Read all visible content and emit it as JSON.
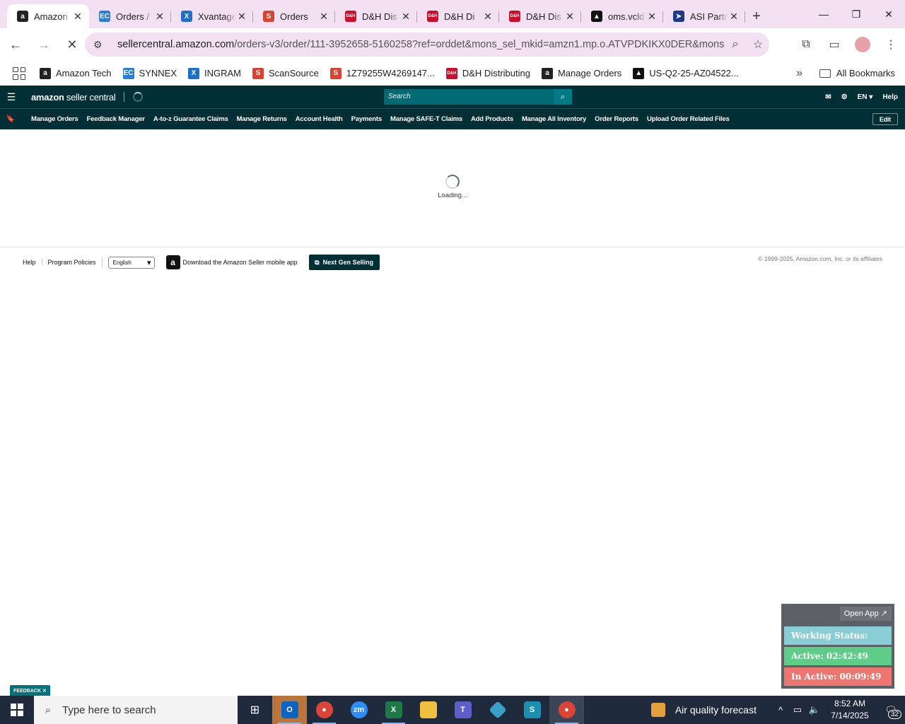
{
  "browser": {
    "tabs": [
      {
        "title": "Amazon",
        "favicon": "amazon-icon",
        "color": "#222222",
        "glyph": "a",
        "active": true
      },
      {
        "title": "Orders /",
        "favicon": "ec-icon",
        "color": "#2a7fd4",
        "glyph": "EC",
        "active": false
      },
      {
        "title": "Xvantage",
        "favicon": "xvantage-icon",
        "color": "#1e6fc9",
        "glyph": "X",
        "active": false
      },
      {
        "title": "Orders",
        "favicon": "scansource-icon",
        "color": "#d9432f",
        "glyph": "S",
        "active": false
      },
      {
        "title": "D&H Dis",
        "favicon": "dh-icon",
        "color": "#c8102e",
        "glyph": "D&H",
        "active": false
      },
      {
        "title": "D&H Di",
        "favicon": "dh-icon",
        "color": "#c8102e",
        "glyph": "D&H",
        "active": false
      },
      {
        "title": "D&H Dis",
        "favicon": "dh-icon",
        "color": "#c8102e",
        "glyph": "D&H",
        "active": false
      },
      {
        "title": "oms.vcld",
        "favicon": "oms-icon",
        "color": "#111111",
        "glyph": "▲",
        "active": false
      },
      {
        "title": "ASI Partn",
        "favicon": "asi-icon",
        "color": "#1b3a8a",
        "glyph": "➤",
        "active": false
      }
    ],
    "url_main": "sellercentral.amazon.com",
    "url_rest": "/orders-v3/order/111-3952658-5160258?ref=orddet&mons_sel_mkid=amzn1.mp.o.ATVPDKIKX0DER&mons_sel...",
    "bookmarks": [
      {
        "label": "Amazon Tech",
        "color": "#222222",
        "glyph": "a"
      },
      {
        "label": "SYNNEX",
        "color": "#2a7fd4",
        "glyph": "EC"
      },
      {
        "label": "INGRAM",
        "color": "#1e6fc9",
        "glyph": "X"
      },
      {
        "label": "ScanSource",
        "color": "#d9432f",
        "glyph": "S"
      },
      {
        "label": "1Z79255W4269147...",
        "color": "#d9432f",
        "glyph": "S"
      },
      {
        "label": "D&H Distributing",
        "color": "#c8102e",
        "glyph": "D&H"
      },
      {
        "label": "Manage Orders",
        "color": "#222222",
        "glyph": "a"
      },
      {
        "label": "US-Q2-25-AZ04522...",
        "color": "#111111",
        "glyph": "▲"
      }
    ],
    "all_bookmarks": "All Bookmarks"
  },
  "seller_central": {
    "logo_bold": "amazon",
    "logo_rest": " seller central",
    "search_placeholder": "Search",
    "lang": "EN ▾",
    "help": "Help",
    "nav": [
      "Manage Orders",
      "Feedback Manager",
      "A-to-z Guarantee Claims",
      "Manage Returns",
      "Account Health",
      "Payments",
      "Manage SAFE-T Claims",
      "Add Products",
      "Manage All Inventory",
      "Order Reports",
      "Upload Order Related Files"
    ],
    "edit": "Edit",
    "loading": "Loading..."
  },
  "footer": {
    "help": "Help",
    "program_policies": "Program Policies",
    "language": "English",
    "download_app": "Download the Amazon Seller mobile app",
    "next_gen": "Next Gen Selling",
    "copyright": "© 1999-2025, Amazon.com, Inc. or its affiliates"
  },
  "widget": {
    "open_app": "Open App ↗",
    "status": "Working Status: Active",
    "active": "Active: 02:42:49",
    "inactive": "In Active: 00:09:49"
  },
  "feedback": "FEEDBACK ✕",
  "taskbar": {
    "search_placeholder": "Type here to search",
    "weather": "Air quality forecast",
    "time": "8:52 AM",
    "date": "7/14/2025",
    "notifications": "32"
  }
}
